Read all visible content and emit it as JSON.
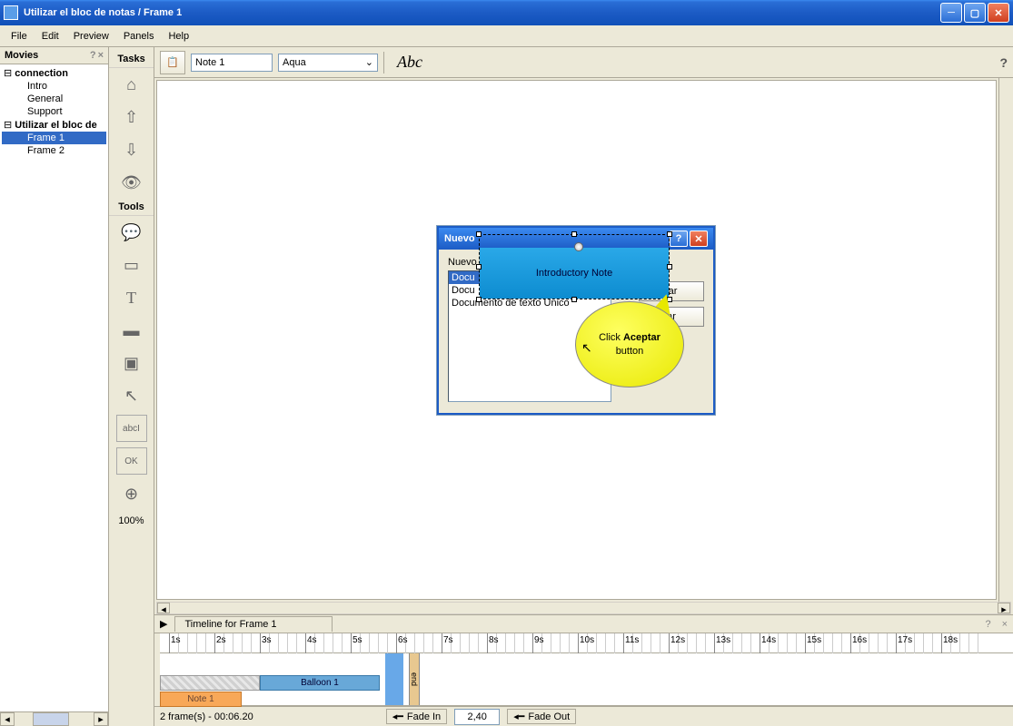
{
  "window": {
    "title": "Utilizar el bloc de notas / Frame 1"
  },
  "menu": [
    "File",
    "Edit",
    "Preview",
    "Panels",
    "Help"
  ],
  "movies_panel": {
    "title": "Movies",
    "tree": {
      "root1": "connection",
      "root1_children": [
        "Intro",
        "General",
        "Support"
      ],
      "root2": "Utilizar el bloc de",
      "root2_children": [
        "Frame 1",
        "Frame 2"
      ],
      "selected": "Frame 1"
    }
  },
  "tasks_label": "Tasks",
  "tools_label": "Tools",
  "zoom": "100%",
  "toolbar": {
    "note_name": "Note 1",
    "style": "Aqua",
    "font_sample": "Abc"
  },
  "dialog": {
    "title": "Nuevo",
    "label": "Nuevo",
    "items": [
      "Docu",
      "Docu",
      "Documento de texto Unico"
    ],
    "btn1": "tar",
    "btn2": "ar"
  },
  "note_overlay": {
    "text": "Introductory Note"
  },
  "bubble": {
    "pre": "Click ",
    "bold": "Aceptar",
    "post": "button"
  },
  "timeline": {
    "title": "Timeline for Frame 1",
    "seconds": [
      "1s",
      "2s",
      "3s",
      "4s",
      "5s",
      "6s",
      "7s",
      "8s",
      "9s",
      "10s",
      "11s",
      "12s",
      "13s",
      "14s",
      "15s",
      "16s",
      "17s",
      "18s"
    ],
    "balloon_clip": "Balloon 1",
    "note_clip": "Note 1",
    "end": "end"
  },
  "status": {
    "frames": "2 frame(s) - 00:06.20",
    "fade_in": "Fade In",
    "time": "2,40",
    "fade_out": "Fade Out"
  },
  "tool_ok": "OK",
  "tool_abc": "abcI"
}
